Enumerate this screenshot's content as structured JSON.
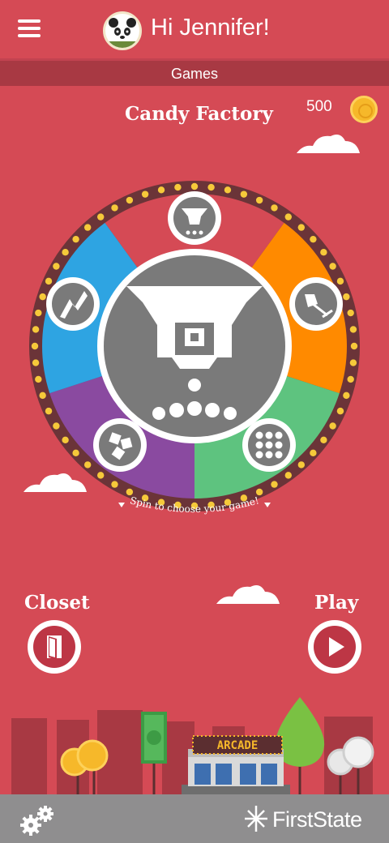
{
  "header": {
    "greeting": "Hi Jennifer!",
    "menu_icon": "hamburger-menu-icon",
    "avatar_icon": "panda-avatar-icon"
  },
  "subheader": {
    "title": "Games"
  },
  "game": {
    "title": "Candy Factory",
    "coins": "500",
    "coin_icon": "gold-coin-icon"
  },
  "wheel": {
    "hint": "Spin to choose your game!",
    "segments": [
      {
        "color": "#ff8a00",
        "icon": "shovel-icon"
      },
      {
        "color": "#5ec37f",
        "icon": "grid-dots-icon"
      },
      {
        "color": "#8a4aa0",
        "icon": "gift-boxes-icon"
      },
      {
        "color": "#2ea4e2",
        "icon": "chart-up-icon"
      },
      {
        "color": "#d54a55",
        "icon": "candy-funnel-icon"
      }
    ],
    "center_icon": "candy-factory-funnel-icon"
  },
  "actions": {
    "closet_label": "Closet",
    "play_label": "Play"
  },
  "scene": {
    "arcade_sign": "ARCADE"
  },
  "footer": {
    "brand": "FirstState",
    "settings_icon": "gears-icon"
  },
  "colors": {
    "background": "#d54a55",
    "subbar": "#a83943",
    "footer": "#8f8e8f",
    "coin": "#f6b82a"
  }
}
